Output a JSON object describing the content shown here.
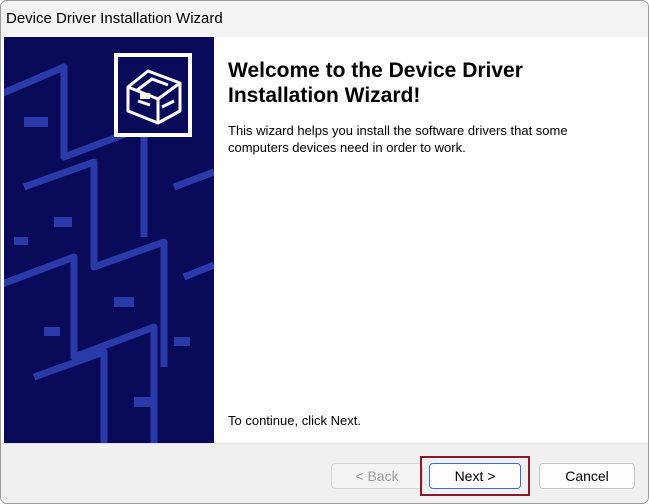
{
  "window": {
    "title": "Device Driver Installation Wizard"
  },
  "content": {
    "heading": "Welcome to the Device Driver Installation Wizard!",
    "intro": "This wizard helps you install the software drivers that some computers devices need in order to work.",
    "continue_hint": "To continue, click Next."
  },
  "footer": {
    "back_label": "< Back",
    "next_label": "Next >",
    "cancel_label": "Cancel"
  },
  "colors": {
    "banner": "#0a0a5a",
    "banner_accent": "#2a3aa8",
    "focus_outline": "#8a1a2a"
  },
  "icons": {
    "banner_logo": "computer-hardware-icon"
  }
}
